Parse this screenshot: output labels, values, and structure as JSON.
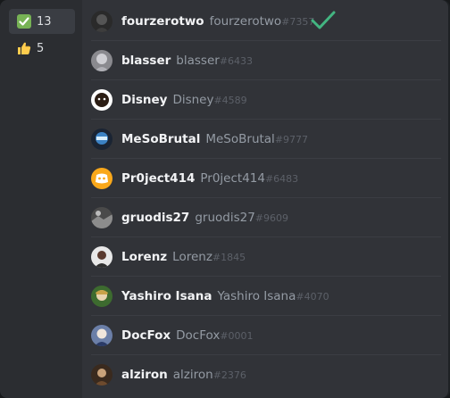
{
  "reactions": [
    {
      "icon": "white-check-mark-emoji",
      "count": "13",
      "selected": true
    },
    {
      "icon": "thumbs-up-emoji",
      "count": "5",
      "selected": false
    }
  ],
  "users": [
    {
      "nickname": "fourzerotwo",
      "username": "fourzerotwo",
      "discriminator": "#7357",
      "avatar": "avatar-dark-character"
    },
    {
      "nickname": "blasser",
      "username": "blasser",
      "discriminator": "#6433",
      "avatar": "avatar-grey-character"
    },
    {
      "nickname": "Disney",
      "username": "Disney",
      "discriminator": "#4589",
      "avatar": "avatar-dark-face"
    },
    {
      "nickname": "MeSoBrutal",
      "username": "MeSoBrutal",
      "discriminator": "#9777",
      "avatar": "avatar-blue-helmet"
    },
    {
      "nickname": "Pr0ject414",
      "username": "Pr0ject414",
      "discriminator": "#6483",
      "avatar": "avatar-discord-default-orange"
    },
    {
      "nickname": "gruodis27",
      "username": "gruodis27",
      "discriminator": "#9609",
      "avatar": "avatar-grey-scene"
    },
    {
      "nickname": "Lorenz",
      "username": "Lorenz",
      "discriminator": "#1845",
      "avatar": "avatar-person-dark"
    },
    {
      "nickname": "Yashiro Isana",
      "username": "Yashiro Isana",
      "discriminator": "#4070",
      "avatar": "avatar-green-character"
    },
    {
      "nickname": "DocFox",
      "username": "DocFox",
      "discriminator": "#0001",
      "avatar": "avatar-blue-character"
    },
    {
      "nickname": "alziron",
      "username": "alziron",
      "discriminator": "#2376",
      "avatar": "avatar-brown-figure"
    }
  ],
  "checkmark_icon": "green-check-icon",
  "colors": {
    "accent_green": "#43b581",
    "discord_orange": "#faa81a"
  }
}
